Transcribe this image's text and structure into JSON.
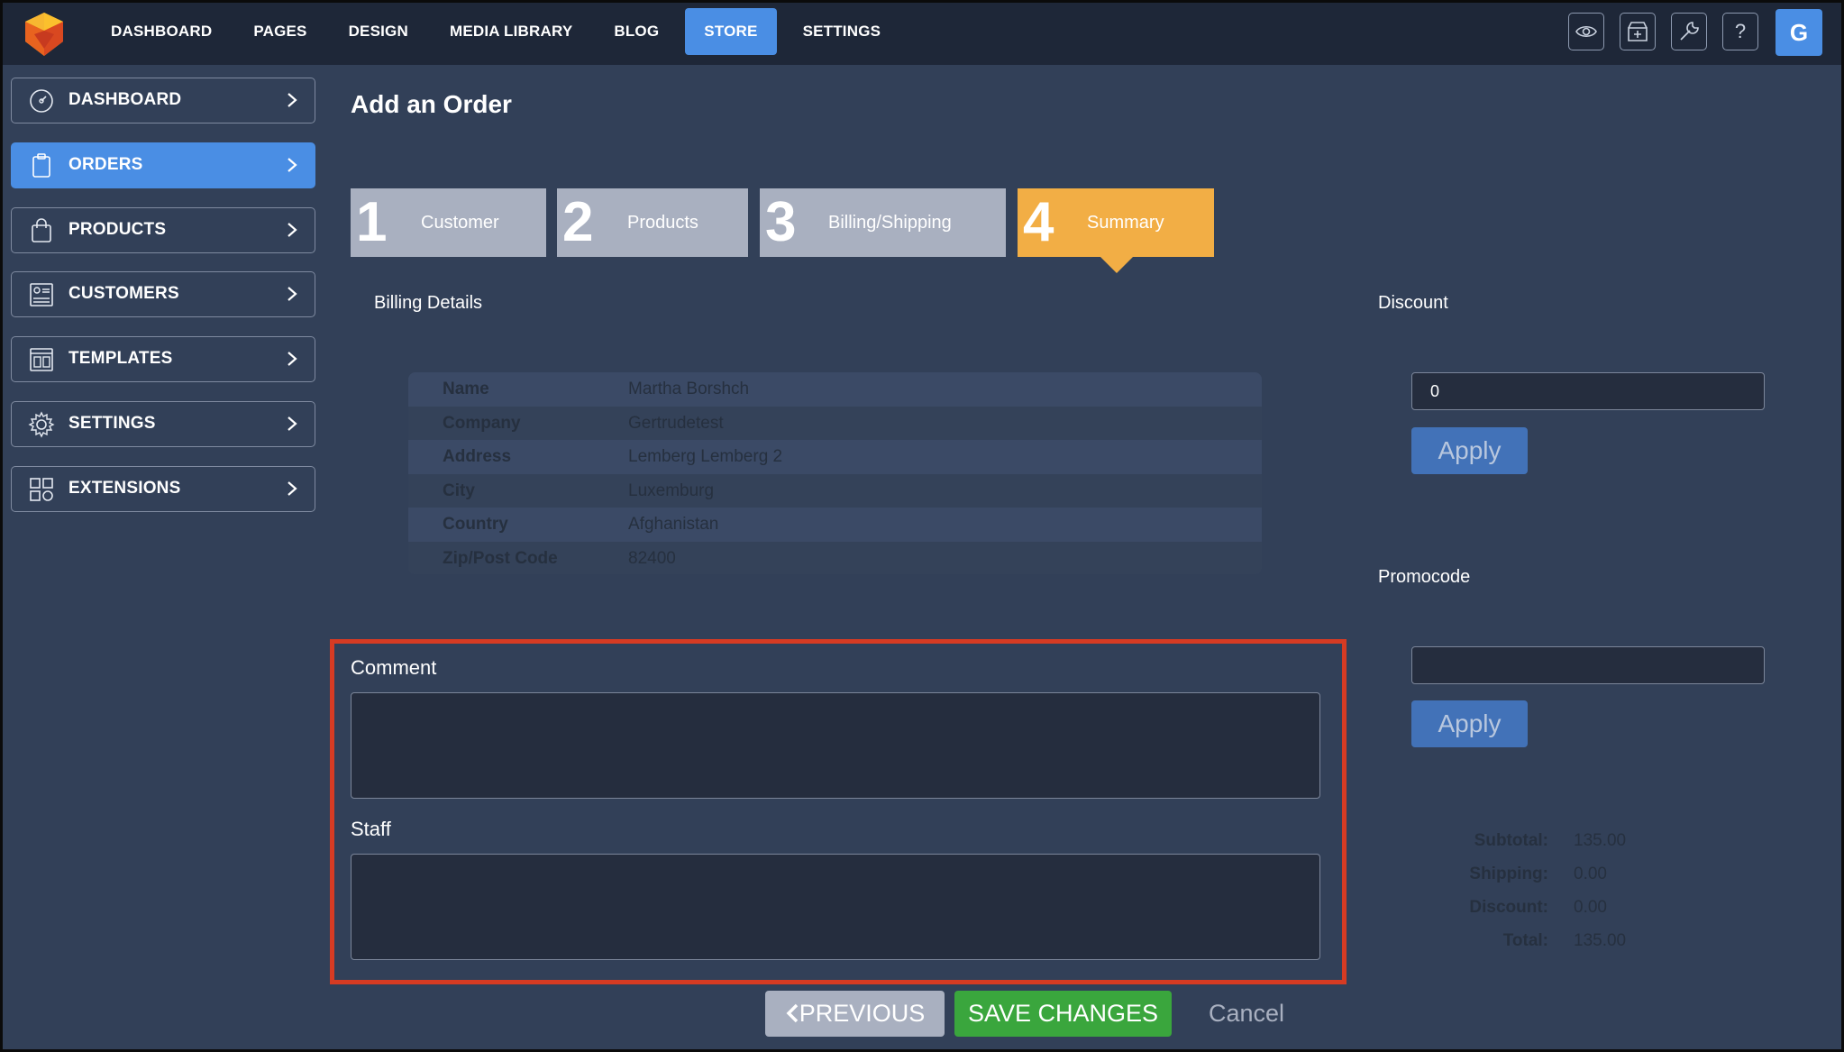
{
  "topnav": {
    "items": [
      {
        "label": "DASHBOARD",
        "active": false
      },
      {
        "label": "PAGES",
        "active": false
      },
      {
        "label": "DESIGN",
        "active": false
      },
      {
        "label": "MEDIA LIBRARY",
        "active": false
      },
      {
        "label": "BLOG",
        "active": false
      },
      {
        "label": "STORE",
        "active": true
      },
      {
        "label": "SETTINGS",
        "active": false
      }
    ],
    "icons": [
      "eye-icon",
      "shop-add-icon",
      "wrench-icon",
      "help-icon"
    ],
    "avatar": "G"
  },
  "sidebar": {
    "items": [
      {
        "label": "DASHBOARD",
        "icon": "gauge-icon",
        "active": false
      },
      {
        "label": "ORDERS",
        "icon": "clipboard-icon",
        "active": true
      },
      {
        "label": "PRODUCTS",
        "icon": "bag-icon",
        "active": false
      },
      {
        "label": "CUSTOMERS",
        "icon": "contacts-icon",
        "active": false
      },
      {
        "label": "TEMPLATES",
        "icon": "template-icon",
        "active": false
      },
      {
        "label": "SETTINGS",
        "icon": "gear-icon",
        "active": false
      },
      {
        "label": "EXTENSIONS",
        "icon": "grid-icon",
        "active": false
      }
    ]
  },
  "main": {
    "title": "Add an Order",
    "steps": [
      {
        "number": "1",
        "label": "Customer",
        "active": false
      },
      {
        "number": "2",
        "label": "Products",
        "active": false
      },
      {
        "number": "3",
        "label": "Billing/Shipping",
        "active": false
      },
      {
        "number": "4",
        "label": "Summary",
        "active": true
      }
    ],
    "billing": {
      "heading": "Billing Details",
      "rows": [
        {
          "key": "Name",
          "value": "Martha Borshch"
        },
        {
          "key": "Company",
          "value": "Gertrudetest"
        },
        {
          "key": "Address",
          "value": "Lemberg Lemberg 2"
        },
        {
          "key": "City",
          "value": "Luxemburg"
        },
        {
          "key": "Country",
          "value": "Afghanistan"
        },
        {
          "key": "Zip/Post Code",
          "value": "82400"
        }
      ]
    },
    "comment": {
      "label": "Comment",
      "value": ""
    },
    "staff": {
      "label": "Staff",
      "value": ""
    },
    "discount": {
      "label": "Discount",
      "value": "0",
      "apply_label": "Apply"
    },
    "promocode": {
      "label": "Promocode",
      "value": "",
      "apply_label": "Apply"
    },
    "totals": [
      {
        "key": "Subtotal:",
        "value": "135.00"
      },
      {
        "key": "Shipping:",
        "value": "0.00"
      },
      {
        "key": "Discount:",
        "value": "0.00"
      },
      {
        "key": "Total:",
        "value": "135.00"
      }
    ],
    "actions": {
      "previous": "PREVIOUS",
      "save": "SAVE CHANGES",
      "cancel": "Cancel"
    }
  },
  "colors": {
    "background": "#324058",
    "topbar": "#1e2738",
    "accent": "#4a8ee4",
    "step_active": "#f2ae45",
    "step_inactive": "#a9b0c0",
    "save": "#3aa63d",
    "highlight_border": "#d63b23"
  }
}
